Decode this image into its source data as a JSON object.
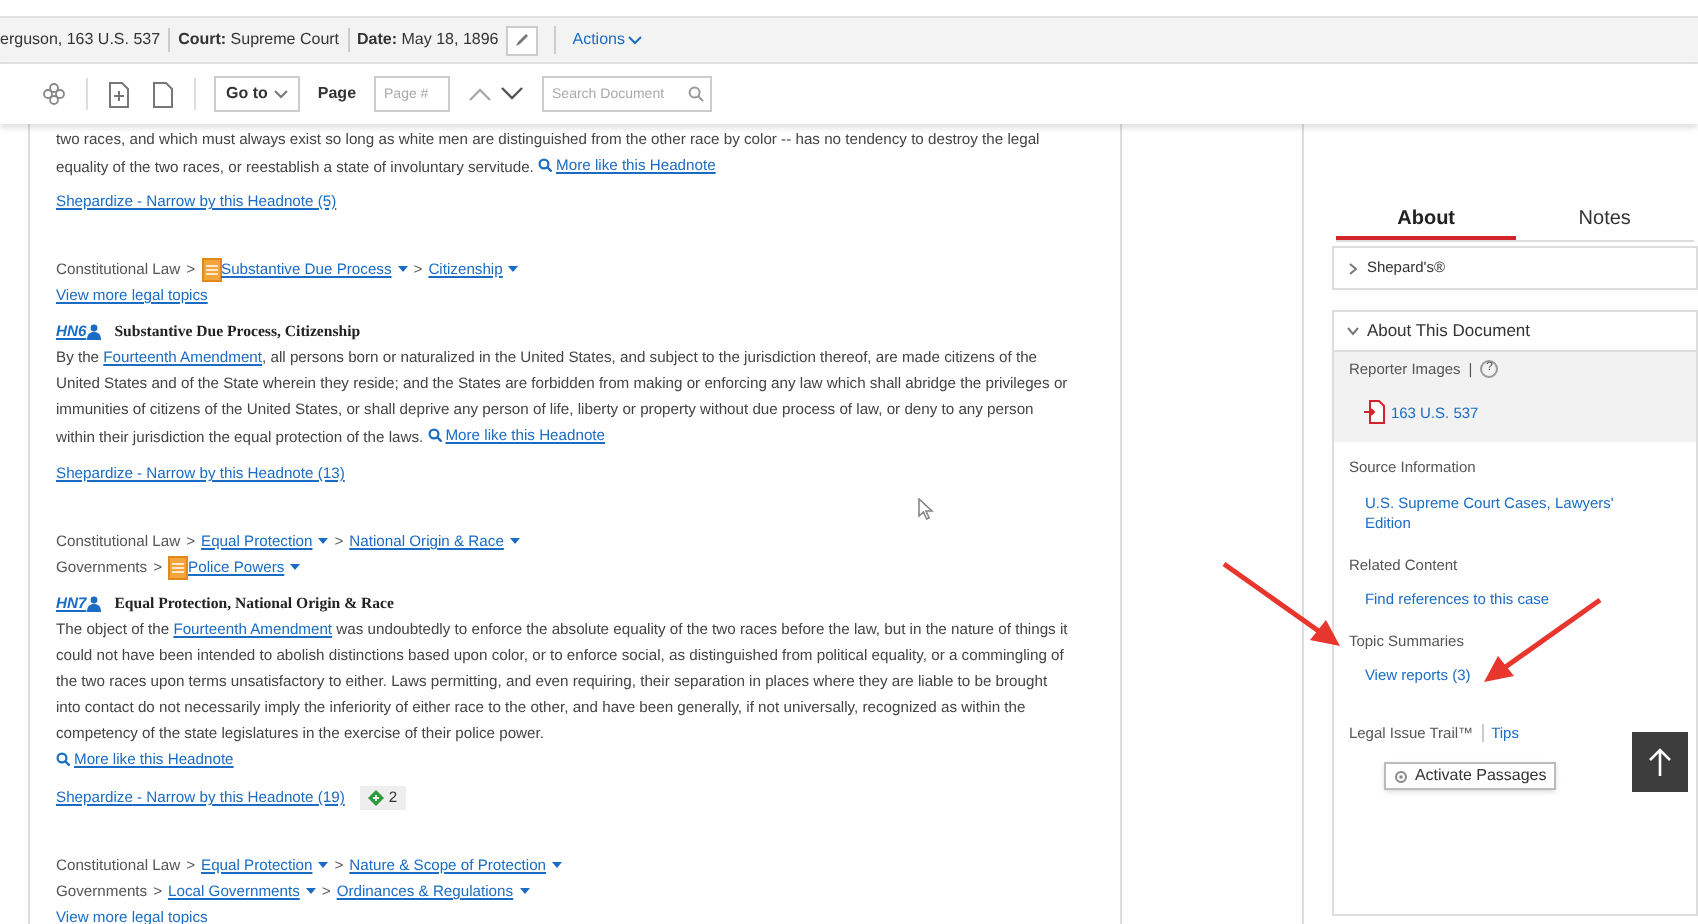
{
  "header": {
    "case": "erguson, 163 U.S. 537",
    "court_label": "Court:",
    "court": "Supreme Court",
    "date_label": "Date:",
    "date": "May 18, 1896",
    "actions": "Actions"
  },
  "toolbar": {
    "goto": "Go to",
    "page_label": "Page",
    "page_placeholder": "Page #",
    "search_placeholder": "Search Document"
  },
  "lead": {
    "text": "two races, and which must always exist so long as white men are distinguished from the other race by color -- has no tendency to destroy the legal equality of the two races, or reestablish a state of involuntary servitude.",
    "more": "More like this Headnote",
    "shepardize": "Shepardize - Narrow by this Headnote (5)"
  },
  "sections": [
    {
      "topics": [
        {
          "separator": ">",
          "crumbs": [
            {
              "text": "Constitutional Law",
              "kind": "plain",
              "flagged": false,
              "dropdown": false
            },
            {
              "text": "Substantive Due Process",
              "kind": "link",
              "flagged": true,
              "dropdown": true
            },
            {
              "text": "Citizenship",
              "kind": "link",
              "flagged": false,
              "dropdown": true
            }
          ]
        }
      ],
      "view_more": "View more legal topics",
      "headnote": {
        "number": "HN6",
        "title": "Substantive Due Process, Citizenship",
        "before": "By the ",
        "link": "Fourteenth Amendment",
        "after": ", all persons born or naturalized in the United States, and subject to the jurisdiction thereof, are made citizens of the United States and of the State wherein they reside; and the States are forbidden from making or enforcing any law which shall abridge the privileges or immunities of citizens of the United States, or shall deprive any person of life, liberty or property without due process of law, or deny to any person within their jurisdiction the equal protection of the laws.",
        "more": "More like this Headnote",
        "more_own_line": false,
        "shepardize": "Shepardize - Narrow by this Headnote (13)"
      }
    },
    {
      "topics": [
        {
          "separator": ">",
          "crumbs": [
            {
              "text": "Constitutional Law",
              "kind": "plain",
              "flagged": false,
              "dropdown": false
            },
            {
              "text": "Equal Protection",
              "kind": "link",
              "flagged": false,
              "dropdown": true
            },
            {
              "text": "National Origin & Race",
              "kind": "link",
              "flagged": false,
              "dropdown": true
            }
          ]
        },
        {
          "separator": ">",
          "crumbs": [
            {
              "text": "Governments",
              "kind": "plain",
              "flagged": false,
              "dropdown": false
            },
            {
              "text": "Police Powers",
              "kind": "link",
              "flagged": true,
              "dropdown": true
            }
          ]
        }
      ],
      "headnote": {
        "number": "HN7",
        "title": "Equal Protection, National Origin & Race",
        "before": "The object of the ",
        "link": "Fourteenth Amendment",
        "after": " was undoubtedly to enforce the absolute equality of the two races before the law, but in the nature of things it could not have been intended to abolish distinctions based upon color, or to enforce social, as distinguished from political equality, or a commingling of the two races upon terms unsatisfactory to either. Laws permitting, and even requiring, their separation in places where they are liable to be brought into contact do not necessarily imply the inferiority of either race to the other, and have been generally, if not universally, recognized as within the competency of the state legislatures in the exercise of their police power.",
        "more": "More like this Headnote",
        "more_own_line": true,
        "shepardize": "Shepardize - Narrow by this Headnote (19)",
        "badge": "2"
      }
    },
    {
      "topics": [
        {
          "separator": ">",
          "crumbs": [
            {
              "text": "Constitutional Law",
              "kind": "plain",
              "flagged": false,
              "dropdown": false
            },
            {
              "text": "Equal Protection",
              "kind": "link",
              "flagged": false,
              "dropdown": true
            },
            {
              "text": "Nature & Scope of Protection",
              "kind": "link",
              "flagged": false,
              "dropdown": true
            }
          ]
        },
        {
          "separator": ">",
          "crumbs": [
            {
              "text": "Governments",
              "kind": "plain",
              "flagged": false,
              "dropdown": false
            },
            {
              "text": "Local Governments",
              "kind": "link",
              "flagged": false,
              "dropdown": true
            },
            {
              "text": "Ordinances & Regulations",
              "kind": "link",
              "flagged": false,
              "dropdown": true
            }
          ]
        }
      ],
      "view_more": "View more legal topics"
    }
  ],
  "sidebar": {
    "tabs": [
      {
        "label": "About",
        "selected": true
      },
      {
        "label": "Notes",
        "selected": false
      }
    ],
    "panels": [
      {
        "title": "Shepard's®",
        "expanded": false
      },
      {
        "title": "About This Document",
        "expanded": true
      }
    ],
    "reporter_label": "Reporter Images",
    "divider": "|",
    "help": "?",
    "reporter_link": "163 U.S. 537",
    "items": [
      {
        "heading": "Source Information",
        "link": "U.S. Supreme Court Cases, Lawyers' Edition"
      },
      {
        "heading": "Related Content",
        "link": "Find references to this case"
      },
      {
        "heading": "Topic Summaries",
        "link": "View reports (3)"
      }
    ],
    "trail_label": "Legal Issue Trail™",
    "tips": "Tips",
    "activate": "Activate Passages"
  }
}
